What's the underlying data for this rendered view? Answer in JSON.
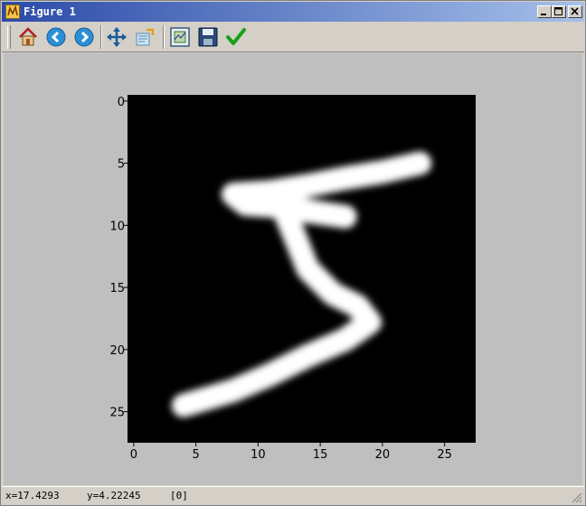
{
  "window": {
    "title": "Figure 1"
  },
  "toolbar": {
    "tools": [
      {
        "name": "home-icon"
      },
      {
        "name": "back-icon"
      },
      {
        "name": "forward-icon"
      },
      {
        "name": "pan-icon"
      },
      {
        "name": "zoom-icon"
      },
      {
        "name": "subplots-icon"
      },
      {
        "name": "save-icon"
      },
      {
        "name": "check-icon"
      }
    ]
  },
  "status": {
    "x": "x=17.4293",
    "y": "y=4.22245",
    "value": "[0]"
  },
  "colors": {
    "image_bg": "#000000",
    "figure_bg": "#bfbfbf",
    "stroke": "#ffffff"
  },
  "chart_data": {
    "type": "heatmap",
    "title": "",
    "xlabel": "",
    "ylabel": "",
    "xlim": [
      -0.5,
      27.5
    ],
    "ylim": [
      27.5,
      -0.5
    ],
    "xticks": [
      "0",
      "5",
      "10",
      "15",
      "20",
      "25"
    ],
    "yticks": [
      "0",
      "5",
      "10",
      "15",
      "20",
      "25"
    ],
    "colormap": "gray",
    "stroke_points": [
      [
        23,
        5
      ],
      [
        20,
        5.7
      ],
      [
        17,
        6.2
      ],
      [
        14,
        6.8
      ],
      [
        11,
        7.3
      ],
      [
        8,
        7.5
      ],
      [
        9,
        8.3
      ],
      [
        12,
        8.5
      ],
      [
        15,
        9
      ],
      [
        17,
        9.3
      ],
      [
        12,
        8.6
      ],
      [
        13,
        11
      ],
      [
        14,
        13.5
      ],
      [
        16,
        15.5
      ],
      [
        18,
        16.5
      ],
      [
        19,
        17.8
      ],
      [
        17,
        19.2
      ],
      [
        14,
        20.5
      ],
      [
        11,
        22
      ],
      [
        8,
        23.3
      ],
      [
        5,
        24.2
      ],
      [
        4,
        24.5
      ]
    ]
  }
}
